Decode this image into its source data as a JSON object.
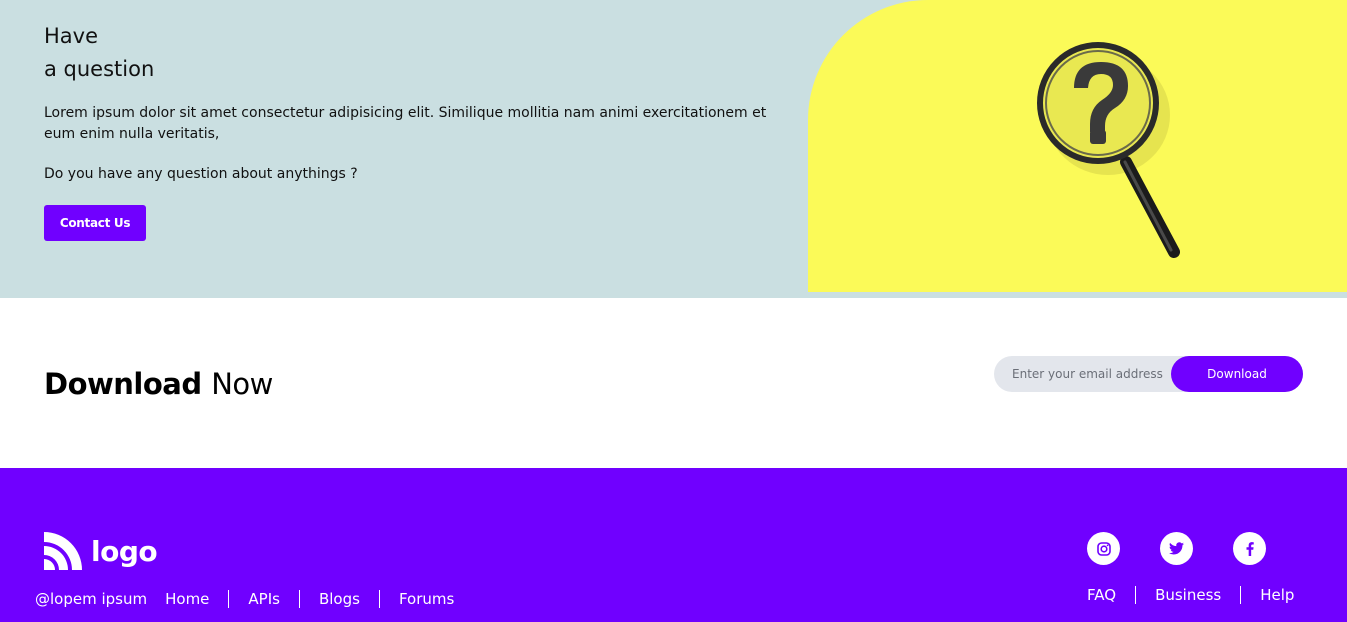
{
  "question": {
    "title_line1": "Have",
    "title_line2": "a question",
    "paragraph": "Lorem ipsum dolor sit amet consectetur adipisicing elit. Similique mollitia nam animi exercitationem et eum enim nulla veritatis,",
    "ask": "Do you have any question about anythings ?",
    "contact_label": "Contact Us",
    "image_icon": "magnifying-glass-question"
  },
  "download": {
    "title_bold": "Download",
    "title_light": "Now",
    "email_placeholder": "Enter your email address",
    "button_label": "Download"
  },
  "footer": {
    "logo_text": "logo",
    "logo_icon": "rss-icon",
    "copyright": "@lopem ipsum",
    "left_links": [
      "Home",
      "APIs",
      "Blogs",
      "Forums"
    ],
    "socials": [
      "instagram-icon",
      "twitter-icon",
      "facebook-icon"
    ],
    "right_links": [
      "FAQ",
      "Business",
      "Help"
    ]
  },
  "colors": {
    "accent": "#7000ff",
    "question_bg": "#cadfe1",
    "yellow": "#fbfa58",
    "input_bg": "#e3e6ec"
  }
}
